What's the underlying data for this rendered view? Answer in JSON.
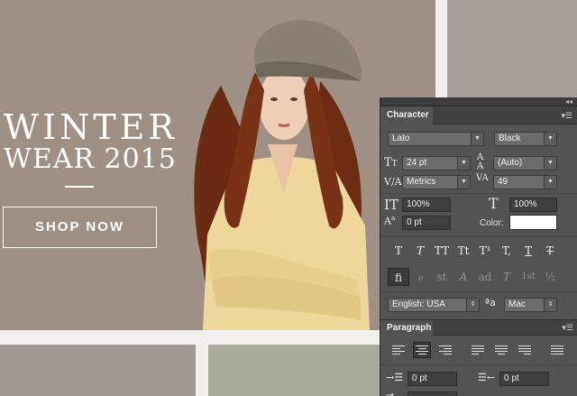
{
  "hero": {
    "headline_line1": "WINTER",
    "headline_line2": "WEAR 2015",
    "cta": "SHOP NOW"
  },
  "colors": {
    "hero_bg": "#9e9085",
    "panel_bg": "#535353",
    "sweater": "#eed79b",
    "hair": "#6a2b12"
  },
  "character_panel": {
    "tab": "Character",
    "font_family": "Lato",
    "font_style": "Black",
    "size": "24 pt",
    "leading": "(Auto)",
    "kerning": "Metrics",
    "tracking": "49",
    "vertical_scale": "100%",
    "horizontal_scale": "100%",
    "baseline_shift": "0 pt",
    "color_label": "Color:",
    "language": "English: USA",
    "anti_alias": "Mac",
    "type_buttons": [
      "T",
      "T",
      "TT",
      "Tt",
      "T¹",
      "T,",
      "T",
      "T"
    ],
    "opentype_buttons": [
      "ﬁ",
      "ℴ",
      "st",
      "A",
      "ad",
      "T",
      "1st",
      "½"
    ]
  },
  "paragraph_panel": {
    "tab": "Paragraph",
    "indent_left": "0 pt",
    "indent_right": "0 pt"
  }
}
